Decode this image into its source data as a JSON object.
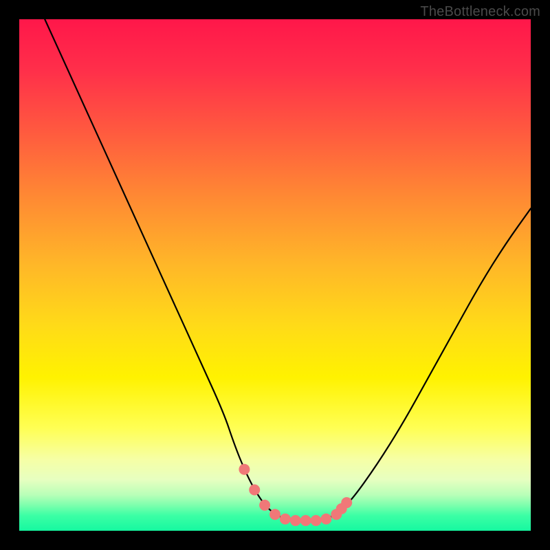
{
  "watermark": {
    "text": "TheBottleneck.com"
  },
  "chart_data": {
    "type": "line",
    "title": "",
    "xlabel": "",
    "ylabel": "",
    "xlim": [
      0,
      100
    ],
    "ylim": [
      0,
      100
    ],
    "grid": false,
    "legend": false,
    "series": [
      {
        "name": "bottleneck-curve",
        "x": [
          5,
          10,
          15,
          20,
          25,
          30,
          35,
          40,
          42,
          44,
          46,
          48,
          50,
          52,
          54,
          56,
          58,
          60,
          62,
          65,
          70,
          75,
          80,
          85,
          90,
          95,
          100
        ],
        "values": [
          100,
          89,
          78,
          67,
          56,
          45,
          34,
          23,
          17,
          12,
          8,
          5,
          3.2,
          2.3,
          2,
          2,
          2,
          2.3,
          3.2,
          6,
          13,
          21,
          30,
          39,
          48,
          56,
          63
        ]
      }
    ],
    "markers": {
      "name": "highlight-points",
      "color": "#f07878",
      "x": [
        44,
        46,
        48,
        50,
        52,
        54,
        56,
        58,
        60,
        62,
        63,
        64
      ],
      "values": [
        12,
        8,
        5,
        3.2,
        2.3,
        2,
        2,
        2,
        2.3,
        3.2,
        4.3,
        5.5
      ]
    },
    "gradient_stops": [
      {
        "pct": 0,
        "color": "#ff174a"
      },
      {
        "pct": 35,
        "color": "#ff8a33"
      },
      {
        "pct": 70,
        "color": "#fff200"
      },
      {
        "pct": 92,
        "color": "#b8ffb8"
      },
      {
        "pct": 100,
        "color": "#16f8a0"
      }
    ]
  }
}
